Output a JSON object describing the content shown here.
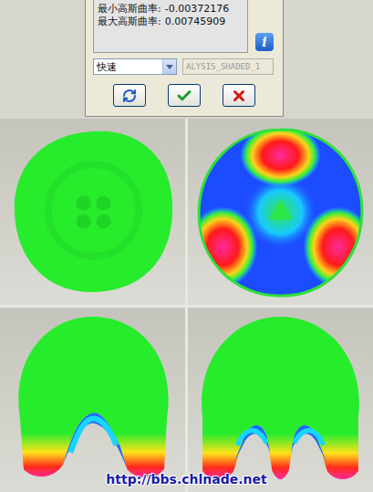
{
  "dialog": {
    "readouts": [
      {
        "label": "最小高斯曲率:",
        "value": "-0.00372176"
      },
      {
        "label": "最大高斯曲率:",
        "value": "0.00745909"
      }
    ],
    "info": "i",
    "quality_select": {
      "value": "快速"
    },
    "name_field": {
      "value": "ALYSIS_SHADED_1",
      "disabled": true
    },
    "buttons": [
      {
        "kind": "refresh"
      },
      {
        "kind": "ok"
      },
      {
        "kind": "cancel"
      }
    ]
  },
  "viewports": [
    {
      "kind": "top-flat"
    },
    {
      "kind": "top-curvature"
    },
    {
      "kind": "front-notch"
    },
    {
      "kind": "front-legs"
    }
  ],
  "watermark": "http://bbs.chlnade.net"
}
